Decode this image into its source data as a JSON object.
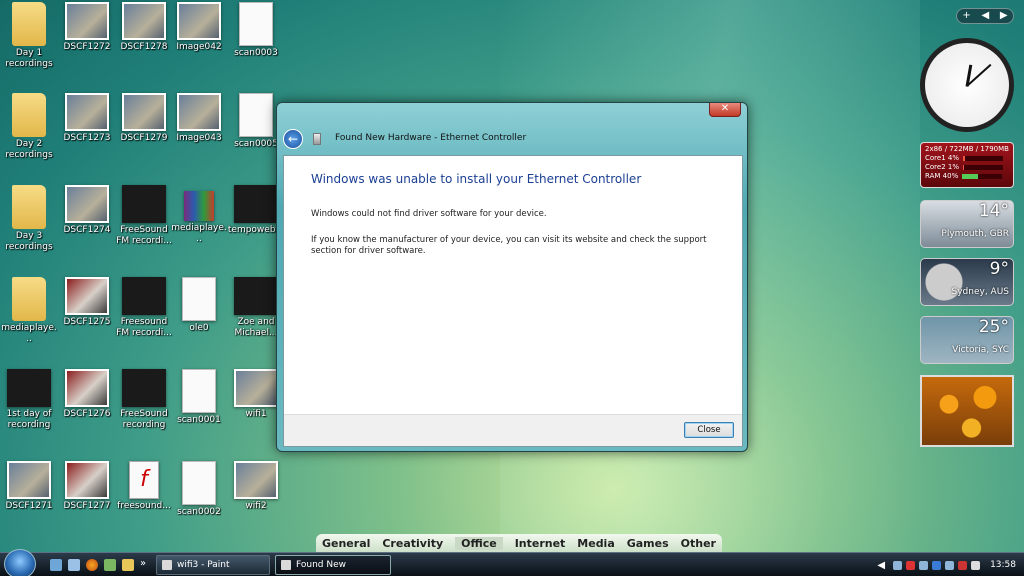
{
  "desktop": {
    "icons": [
      {
        "label": "Day 1 recordings",
        "type": "folder"
      },
      {
        "label": "DSCF1272",
        "type": "photo"
      },
      {
        "label": "DSCF1278",
        "type": "photo"
      },
      {
        "label": "Image042",
        "type": "photo"
      },
      {
        "label": "scan0003",
        "type": "doc"
      },
      {
        "label": "Day 2 recordings",
        "type": "folder"
      },
      {
        "label": "DSCF1273",
        "type": "photo"
      },
      {
        "label": "DSCF1279",
        "type": "photo"
      },
      {
        "label": "Image043",
        "type": "photo"
      },
      {
        "label": "scan0005",
        "type": "doc"
      },
      {
        "label": "Day 3 recordings",
        "type": "folder"
      },
      {
        "label": "DSCF1274",
        "type": "photo"
      },
      {
        "label": "FreeSound FM recordi...",
        "type": "film"
      },
      {
        "label": "mediaplaye...",
        "type": "rar"
      },
      {
        "label": "tempoweb...",
        "type": "film"
      },
      {
        "label": "mediaplaye...",
        "type": "folder"
      },
      {
        "label": "DSCF1275",
        "type": "red"
      },
      {
        "label": "Freesound FM recordi...",
        "type": "film"
      },
      {
        "label": "ole0",
        "type": "doc"
      },
      {
        "label": "Zoe and Michael...",
        "type": "film"
      },
      {
        "label": "1st day of recording",
        "type": "film"
      },
      {
        "label": "DSCF1276",
        "type": "red"
      },
      {
        "label": "FreeSound recording",
        "type": "film"
      },
      {
        "label": "scan0001",
        "type": "doc"
      },
      {
        "label": "wifi1",
        "type": "photo"
      },
      {
        "label": "DSCF1271",
        "type": "photo"
      },
      {
        "label": "DSCF1277",
        "type": "red"
      },
      {
        "label": "freesound...",
        "type": "flash"
      },
      {
        "label": "scan0002",
        "type": "doc"
      },
      {
        "label": "wifi2",
        "type": "photo"
      }
    ]
  },
  "sidebar": {
    "controls": {
      "add": "+",
      "prev": "◀",
      "next": "▶"
    },
    "cpu": {
      "header": "2x86 / 722MB / 1790MB",
      "core1_label": "Core1",
      "core1_value": "4%",
      "core1_fill": 0.04,
      "core2_label": "Core2",
      "core2_value": "1%",
      "core2_fill": 0.01,
      "ram_label": "RAM",
      "ram_value": "40%",
      "ram_fill": 0.4
    },
    "weather": [
      {
        "temp": "14°",
        "city": "Plymouth, GBR"
      },
      {
        "temp": "9°",
        "city": "Sydney, AUS"
      },
      {
        "temp": "25°",
        "city": "Victoria, SYC"
      }
    ]
  },
  "dialog": {
    "title": "Found New Hardware - Ethernet Controller",
    "close_x": "✕",
    "back": "←",
    "heading": "Windows was unable to install your Ethernet Controller",
    "p1": "Windows could not find driver software for your device.",
    "p2": "If you know the manufacturer of your device, you can visit its website and check the support section for driver software.",
    "close_button": "Close"
  },
  "categories": [
    "General",
    "Creativity",
    "Office",
    "Internet",
    "Media",
    "Games",
    "Other"
  ],
  "taskbar": {
    "overflow": "»",
    "tasks": [
      {
        "label": "wifi3 - Paint"
      },
      {
        "label": "Found New Hardwa..."
      }
    ],
    "tray_chevron": "◀",
    "time": "13:58"
  }
}
